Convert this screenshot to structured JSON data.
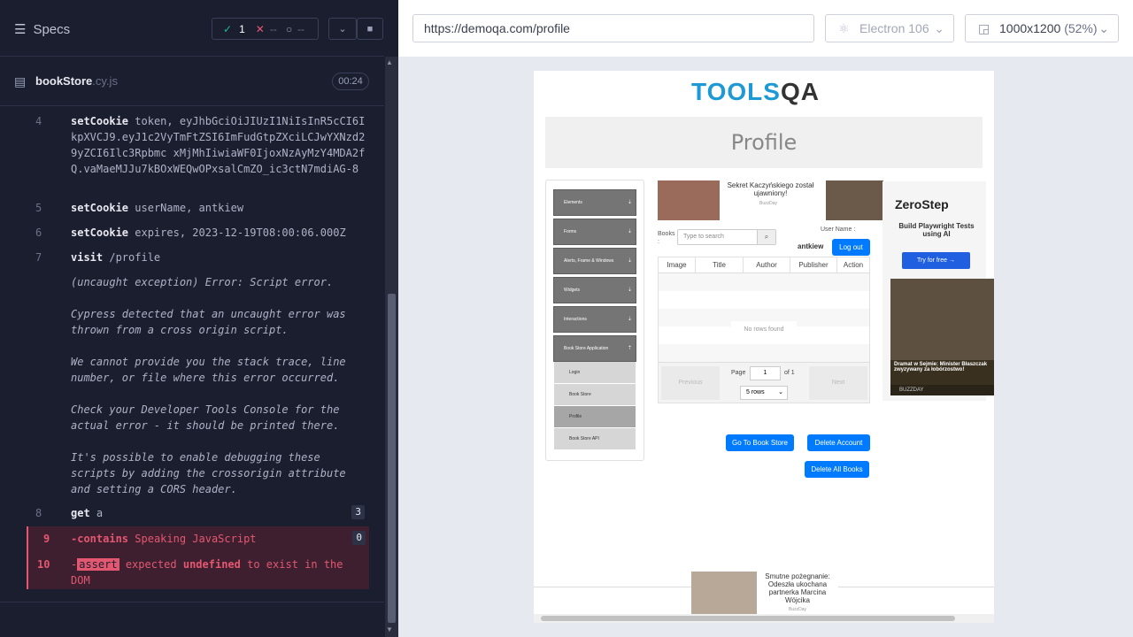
{
  "runner": {
    "specs_label": "Specs",
    "stats": {
      "passed": "1",
      "failed": "--",
      "pending": "--"
    },
    "file": {
      "name": "bookStore",
      "ext": ".cy.js",
      "duration": "00:24"
    },
    "commands": [
      {
        "num": "4",
        "name": "setCookie",
        "message": "token, eyJhbGciOiJIUzI1NiIsInR5cCI6IkpXVCJ9.eyJ1c2VyTmFtZSI6ImFudGtpZXciLCJwYXNzd29yZCI6Ilc3Rpbmc xMjMhIiwiaWF0IjoxNzAyMzY4MDA2fQ.vaMaeMJJu7kBOxWEQwOPxsalCmZO_ic3ctN7mdiAG-8"
      },
      {
        "num": "5",
        "name": "setCookie",
        "message": "userName, antkiew"
      },
      {
        "num": "6",
        "name": "setCookie",
        "message": "expires, 2023-12-19T08:00:06.000Z"
      },
      {
        "num": "7",
        "name": "visit",
        "message": "/profile"
      }
    ],
    "error_lines": [
      "(uncaught exception)  Error: Script error.",
      "Cypress detected that an uncaught error was thrown from a cross origin script.",
      "We cannot provide you the stack trace, line number, or file where this error occurred.",
      "Check your Developer Tools Console for the actual error - it should be printed there.",
      "It's possible to enable debugging these scripts by adding the crossorigin attribute and setting a CORS header."
    ],
    "cmd8": {
      "num": "8",
      "name": "get",
      "message": "a",
      "count": "3"
    },
    "cmd9": {
      "num": "9",
      "name": "-contains",
      "message": "Speaking JavaScript",
      "count": "0"
    },
    "cmd10": {
      "num": "10",
      "prefix": "-",
      "tag": "assert",
      "text_a": "expected",
      "bold": "undefined",
      "text_b": "to exist in the DOM"
    }
  },
  "browser": {
    "url": "https://demoqa.com/profile",
    "engine": "Electron 106",
    "viewport": "1000x1200",
    "zoom": "(52%)"
  },
  "aut": {
    "logo_a": "TOOLS",
    "logo_b": "QA",
    "page_title": "Profile",
    "nav_groups": [
      "Elements",
      "Forms",
      "Alerts, Frame & Windows",
      "Widgets",
      "Interactions",
      "Book Store Application"
    ],
    "nav_items": [
      "Login",
      "Book Store",
      "Profile",
      "Book Store API"
    ],
    "books_label": "Books :",
    "search_placeholder": "Type to search",
    "username_label": "User Name :",
    "username_value": "antkiew",
    "logout": "Log out",
    "columns": [
      "Image",
      "Title",
      "Author",
      "Publisher",
      "Action"
    ],
    "no_rows": "No rows found",
    "previous": "Previous",
    "next": "Next",
    "page_label": "Page",
    "page_value": "1",
    "of_label": "of 1",
    "rows_select": "5 rows",
    "go_to_store": "Go To Book Store",
    "delete_account": "Delete Account",
    "delete_all": "Delete All Books",
    "ad1": {
      "title": "Sekret Kaczyńskiego został ujawniony!",
      "source": "BuzzDay"
    },
    "ad2": {
      "brand": "ZeroStep",
      "line": "Build Playwright Tests using AI",
      "cta": "Try for free →"
    },
    "ad3": {
      "title": "Dramat w Sejmie: Minister Błaszczak zwyzywany za łobórzostwo!",
      "source": "BUZZDAY"
    },
    "ad4": {
      "title": "Smutne pożegnanie: Odeszła ukochana partnerka Marcina Wójcika",
      "source": "BuzzDay"
    }
  }
}
